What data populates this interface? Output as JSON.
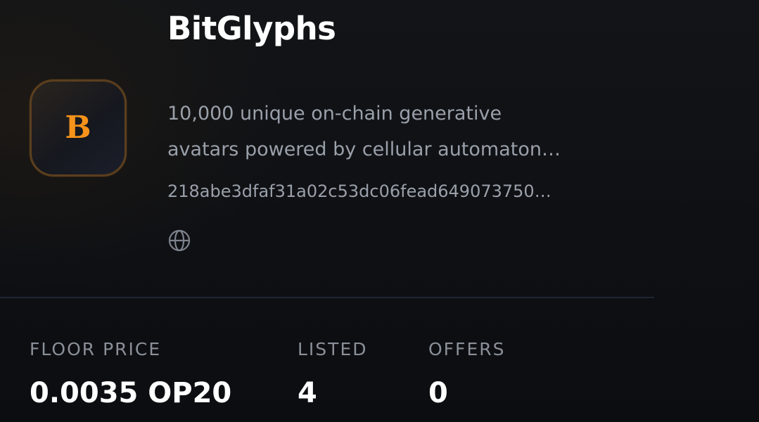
{
  "collection": {
    "name": "BitGlyphs",
    "logo_letter": "B",
    "logo_accent": "#f7931a",
    "description_lines": [
      "10,000 unique on-chain generative",
      "avatars powered by cellular automaton…"
    ],
    "contract_address": "218abe3dfaf31a02c53dc06fead649073750…",
    "website_icon": "globe-icon"
  },
  "stats": {
    "floor_price": {
      "label": "FLOOR PRICE",
      "value": "0.0035 OP20"
    },
    "listed": {
      "label": "LISTED",
      "value": "4"
    },
    "offers": {
      "label": "OFFERS",
      "value": "0"
    }
  }
}
